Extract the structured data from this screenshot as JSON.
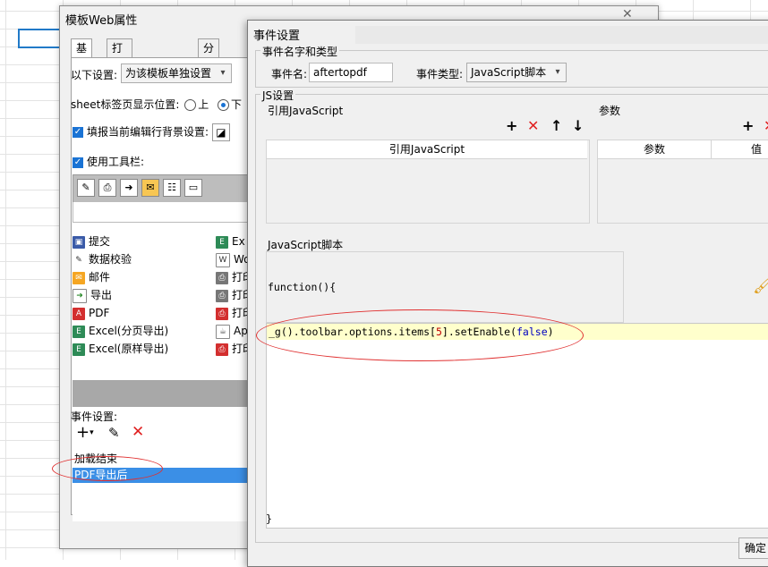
{
  "back_window": {
    "title": "模板Web属性",
    "close_glyph": "✕",
    "tabs": [
      "基本",
      "打印机(服务器)",
      "分页预览"
    ],
    "settings_label": "以下设置:",
    "settings_combo_value": "为该模板单独设置",
    "sheet_position_label": "sheet标签页显示位置:",
    "radio_top_label": "上",
    "radio_bottom_label": "下",
    "fill_bg_label": "填报当前编辑行背景设置:",
    "use_toolbar_label": "使用工具栏:",
    "toolbar_items_left": [
      {
        "icon": "submit-icon",
        "label": "提交"
      },
      {
        "icon": "validate-icon",
        "label": "数据校验"
      },
      {
        "icon": "mail-icon",
        "label": "邮件"
      },
      {
        "icon": "export-icon",
        "label": "导出"
      },
      {
        "icon": "pdf-icon",
        "label": "PDF"
      },
      {
        "icon": "excel-icon",
        "label": "Excel(分页导出)"
      },
      {
        "icon": "excel-icon",
        "label": "Excel(原样导出)"
      }
    ],
    "toolbar_items_right": [
      {
        "icon": "excel-icon",
        "label": "Ex"
      },
      {
        "icon": "word-icon",
        "label": "Wo"
      },
      {
        "icon": "print-icon",
        "label": "打印"
      },
      {
        "icon": "print-icon",
        "label": "打印"
      },
      {
        "icon": "pdf-print-icon",
        "label": "打印"
      },
      {
        "icon": "applet-icon",
        "label": "App"
      },
      {
        "icon": "pdf-print-icon",
        "label": "打印"
      }
    ],
    "event_settings_label": "事件设置:",
    "events": [
      "加载结束",
      "PDF导出后"
    ]
  },
  "front_window": {
    "title": "事件设置",
    "name_type_group": "事件名字和类型",
    "event_name_label": "事件名:",
    "event_name_value": "aftertopdf",
    "event_type_label": "事件类型:",
    "event_type_value": "JavaScript脚本",
    "js_group": "JS设置",
    "ref_js_label": "引用JavaScript",
    "ref_js_column": "引用JavaScript",
    "params_label": "参数",
    "params_col1": "参数",
    "params_col2": "值",
    "script_label": "JavaScript脚本",
    "function_header": "function(){",
    "code_prefix": "_g().toolbar.options.items",
    "code_index_open": "[",
    "code_index": "5",
    "code_index_close": "]",
    "code_method": ".setEnable(",
    "code_arg": "false",
    "code_close": ")",
    "function_footer": "}",
    "ok_label": "确定",
    "toolbar_glyphs": {
      "add": "+",
      "delete": "✕",
      "up": "↑",
      "down": "↓"
    }
  },
  "colors": {
    "accent": "#1a73d4",
    "selection": "#3b8fe6",
    "delete_red": "#e02020",
    "annotation_red": "#e03030",
    "code_highlight": "#ffffcc",
    "keyword_blue": "#0000c0",
    "number_red": "#c00000"
  }
}
